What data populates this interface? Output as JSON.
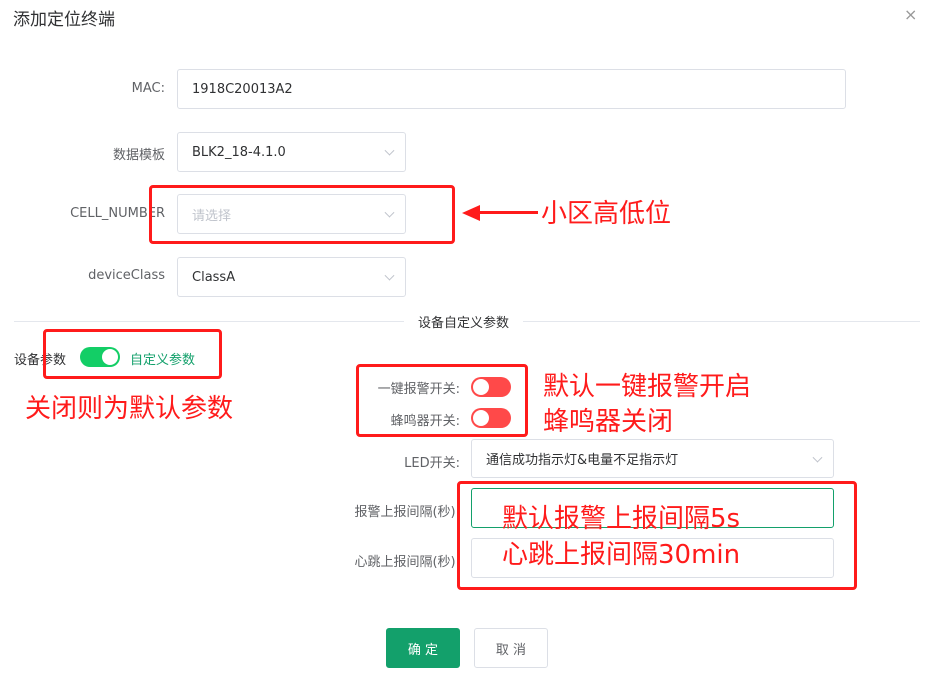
{
  "dialog": {
    "title": "添加定位终端",
    "close_symbol": "×"
  },
  "form": {
    "mac_label": "MAC:",
    "mac_value": "1918C20013A2",
    "template_label": "数据模板",
    "template_value": "BLK2_18-4.1.0",
    "cell_label": "CELL_NUMBER",
    "cell_placeholder": "请选择",
    "device_class_label": "deviceClass",
    "device_class_value": "ClassA"
  },
  "custom_section": {
    "divider_title": "设备自定义参数",
    "device_param_label": "设备参数",
    "device_param_switch_state": "on",
    "device_param_switch_text": "自定义参数",
    "alarm_switch_label": "一键报警开关:",
    "alarm_switch_state": "off",
    "buzzer_switch_label": "蜂鸣器开关:",
    "buzzer_switch_state": "off",
    "led_label": "LED开关:",
    "led_value": "通信成功指示灯&电量不足指示灯",
    "alarm_interval_label": "报警上报间隔(秒):",
    "alarm_interval_value": "",
    "heartbeat_interval_label": "心跳上报间隔(秒):",
    "heartbeat_interval_value": ""
  },
  "buttons": {
    "confirm": "确 定",
    "cancel": "取 消"
  },
  "annotations": {
    "cell_note": "小区高低位",
    "device_param_note": "关闭则为默认参数",
    "switch_note_line1": "默认一键报警开启",
    "switch_note_line2": "蜂鸣器关闭",
    "interval_note_line1": "默认报警上报间隔5s",
    "interval_note_line2": "心跳上报间隔30min",
    "color": "#ff1b1b"
  },
  "colors": {
    "primary": "#13a06b",
    "switch_on": "#13ce66",
    "switch_off": "#ff4949"
  }
}
